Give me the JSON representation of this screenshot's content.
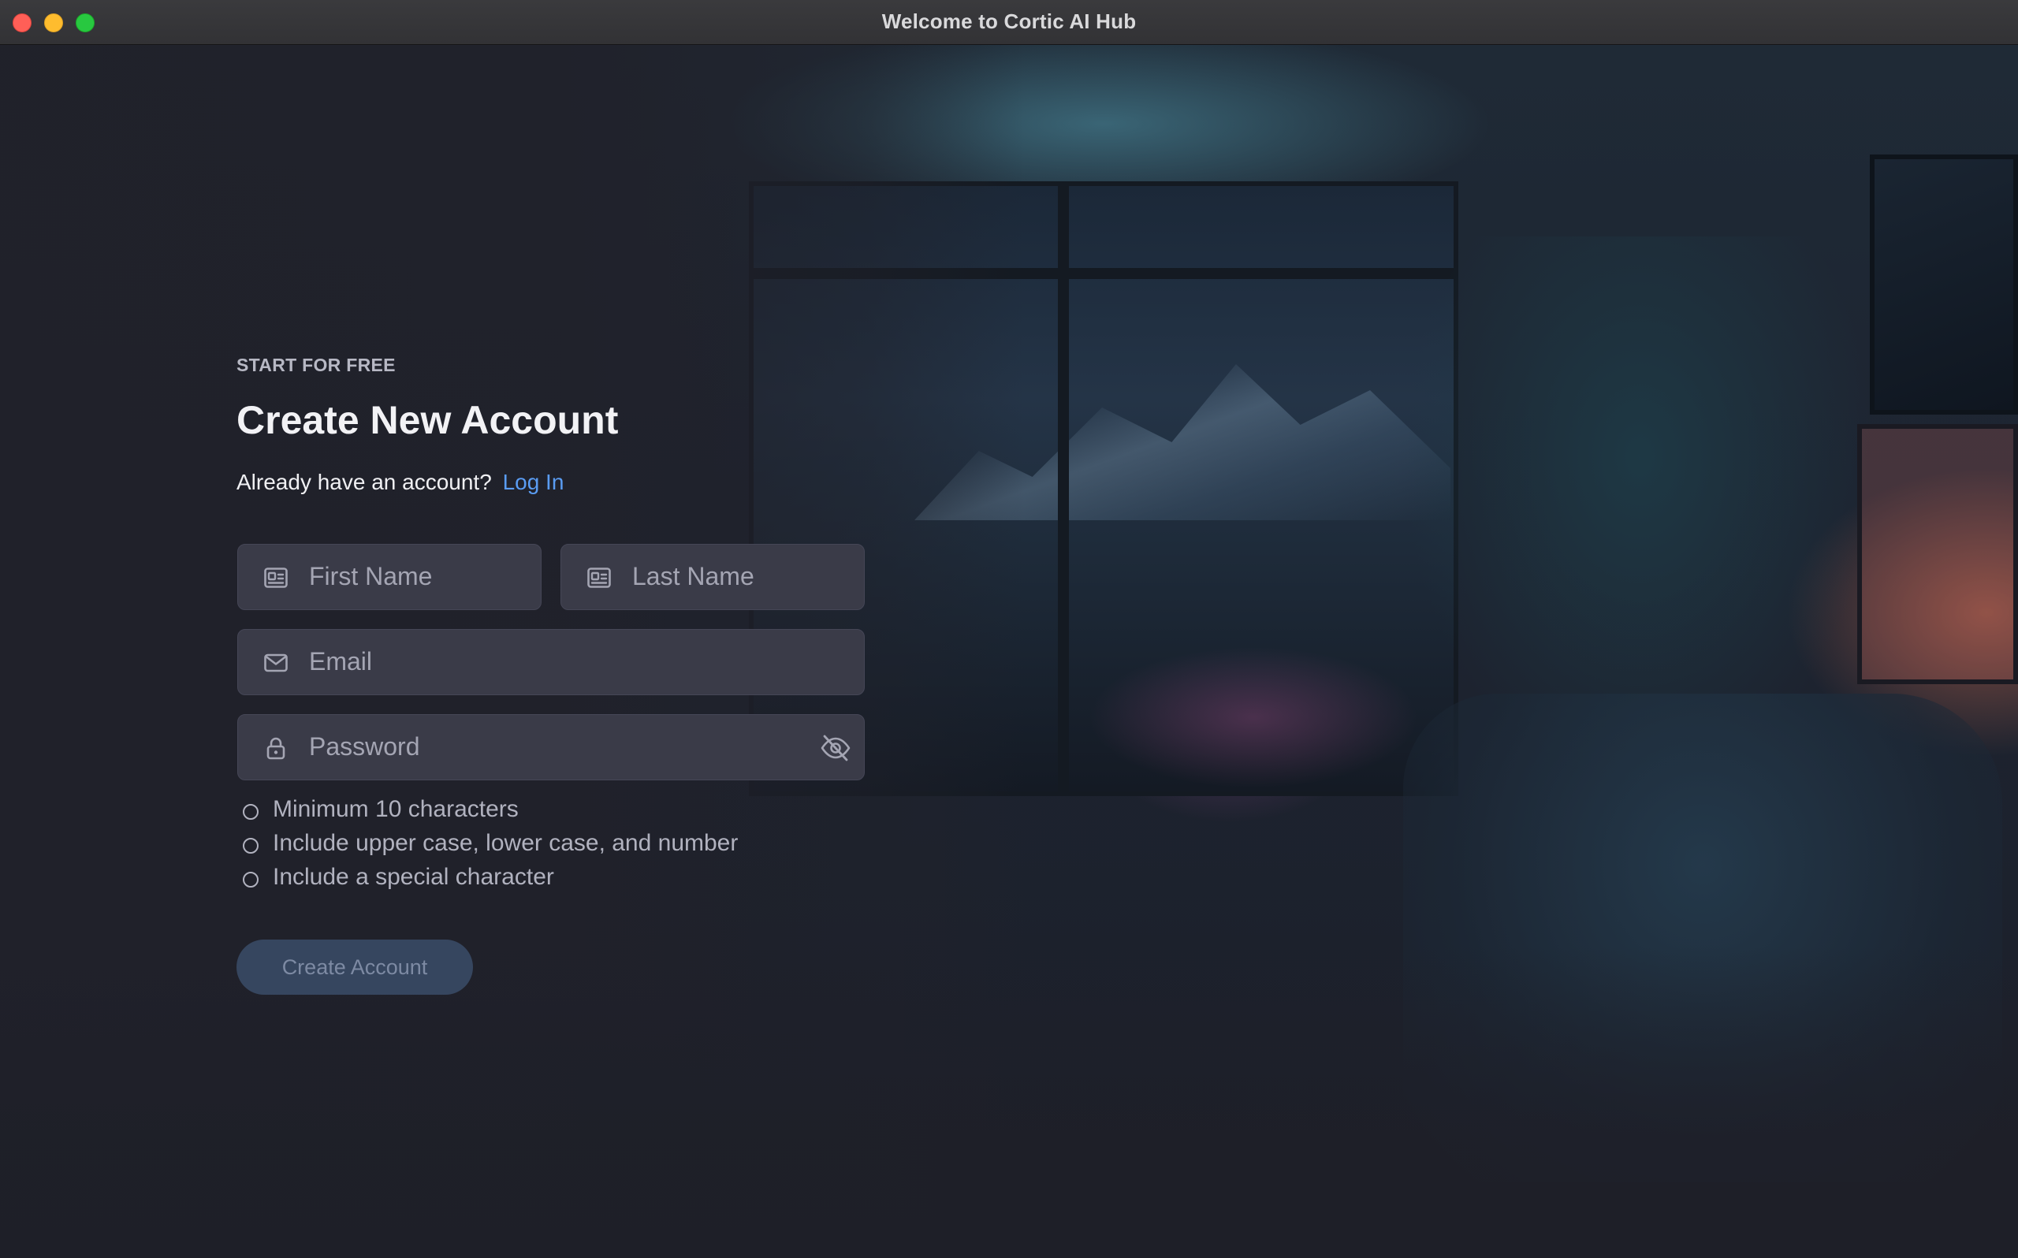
{
  "window": {
    "title": "Welcome to Cortic AI Hub"
  },
  "form": {
    "eyebrow": "START FOR FREE",
    "heading": "Create New Account",
    "login_prompt": "Already have an account?",
    "login_link": "Log In",
    "first_name_placeholder": "First Name",
    "last_name_placeholder": "Last Name",
    "email_placeholder": "Email",
    "password_placeholder": "Password",
    "requirements": [
      "Minimum 10 characters",
      "Include upper case, lower case, and number",
      "Include a special character"
    ],
    "submit_label": "Create Account"
  },
  "icons": {
    "first_name": "id-card-icon",
    "last_name": "id-card-icon",
    "email": "mail-icon",
    "password": "lock-icon",
    "toggle_password": "eye-off-icon"
  },
  "colors": {
    "accent_link": "#5a9cf2",
    "button_bg": "#36465f",
    "field_bg": "#3a3b48"
  }
}
